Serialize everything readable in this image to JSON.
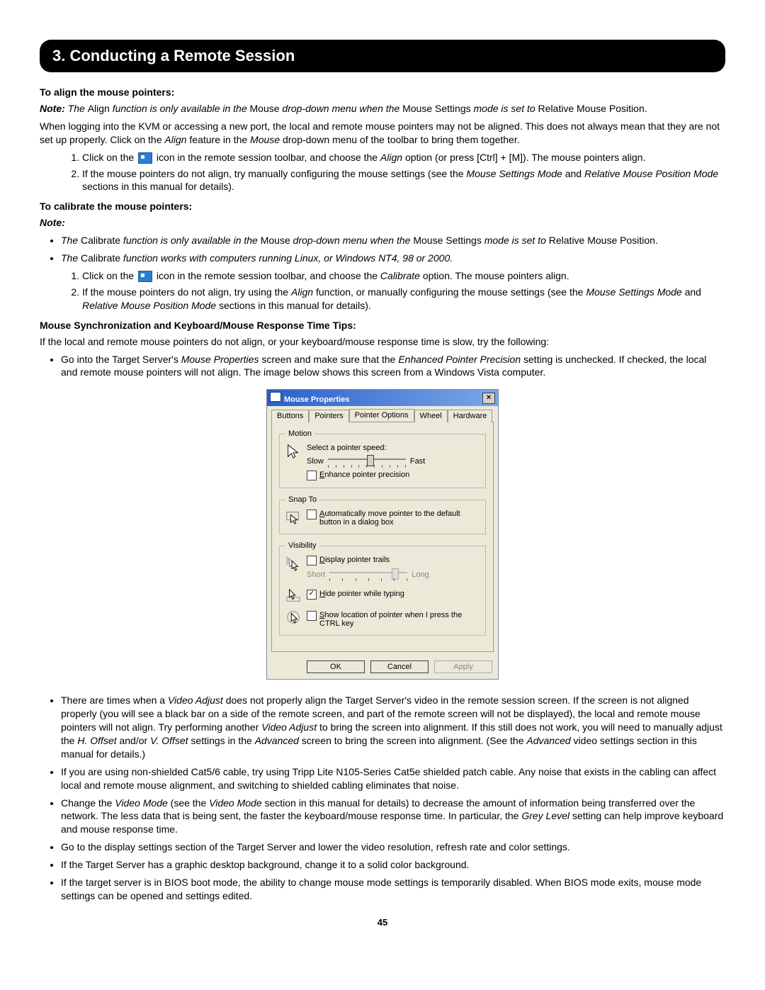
{
  "header": {
    "section_title": "3. Conducting a Remote Session"
  },
  "align": {
    "heading": "To align the mouse pointers:",
    "note_label": "Note:",
    "note_pre": " The ",
    "note_align_word": "Align",
    "note_mid1": " function is only available in the ",
    "note_mouse_word": "Mouse",
    "note_mid2": " drop-down menu when the ",
    "note_settings_word": "Mouse Settings",
    "note_mid3": " mode is set to ",
    "note_relative_word": "Relative Mouse Position.",
    "para1": "When logging into the KVM or accessing a new port, the local and remote mouse pointers may not be aligned. This does not always mean that they are not set up properly. Click on the ",
    "para1_em1": "Align",
    "para1_mid": " feature in the ",
    "para1_em2": "Mouse",
    "para1_end": " drop-down menu of the toolbar to bring them together.",
    "step1_a": "Click on the ",
    "step1_b": " icon in the remote session toolbar, and choose the ",
    "step1_em": "Align",
    "step1_c": " option (or press [Ctrl] + [M]). The mouse pointers align.",
    "step2_a": "If the mouse pointers do not align, try manually configuring the mouse settings (see the ",
    "step2_em1": "Mouse Settings Mode",
    "step2_mid": " and ",
    "step2_em2": "Relative Mouse Position Mode",
    "step2_end": " sections in this manual for details)."
  },
  "calibrate": {
    "heading": "To calibrate the mouse pointers:",
    "note_label": "Note:",
    "b1_a": "The ",
    "b1_cal": "Calibrate",
    "b1_b": " function is only available in the ",
    "b1_mouse": "Mouse",
    "b1_c": " drop-down menu when the ",
    "b1_settings": "Mouse Settings",
    "b1_d": " mode is set to ",
    "b1_relative": "Relative Mouse Position.",
    "b2_a": "The ",
    "b2_cal": "Calibrate",
    "b2_b": " function works with computers running Linux, or Windows NT4, 98 or 2000.",
    "step1_a": "Click on the ",
    "step1_b": " icon in the remote session toolbar, and choose the ",
    "step1_em": "Calibrate",
    "step1_c": " option. The mouse pointers align.",
    "step2_a": "If the mouse pointers do not align, try using the ",
    "step2_em1": "Align",
    "step2_b": " function, or manually configuring the mouse settings (see the ",
    "step2_em2": "Mouse Settings Mode",
    "step2_mid": " and ",
    "step2_em3": "Relative Mouse Position Mode",
    "step2_end": " sections in this manual for details)."
  },
  "sync": {
    "heading": "Mouse Synchronization and Keyboard/Mouse Response Time Tips:",
    "intro": "If the local and remote mouse pointers do not align, or your keyboard/mouse response time is slow, try the following:",
    "b1_a": "Go into the Target Server's ",
    "b1_em1": "Mouse Properties",
    "b1_b": " screen and make sure that the ",
    "b1_em2": "Enhanced Pointer Precision",
    "b1_c": " setting is unchecked. If checked, the local and remote mouse pointers will not align. The image below shows this screen from a Windows Vista computer.",
    "b2_a": "There are times when a ",
    "b2_em1": "Video Adjust",
    "b2_b": " does not properly align the Target Server's video in the remote session screen. If the screen is not aligned properly (you will see a black bar on a side of the remote screen, and part of the remote screen will not be displayed), the local and remote mouse pointers will not align. Try performing another ",
    "b2_em2": "Video Adjust",
    "b2_c": " to bring the screen into alignment. If this still does not work, you will need to manually adjust the ",
    "b2_em3": "H. Offset",
    "b2_d": " and/or ",
    "b2_em4": "V. Offset",
    "b2_e": " settings in the ",
    "b2_em5": "Advanced",
    "b2_f": " screen to bring the screen into alignment. (See the ",
    "b2_em6": "Advanced",
    "b2_g": " video settings section in this manual for details.)",
    "b3": "If you are using non-shielded Cat5/6 cable, try using Tripp Lite N105-Series Cat5e shielded patch cable. Any noise that exists in the cabling can affect local and remote mouse alignment, and switching to shielded cabling eliminates that noise.",
    "b4_a": "Change the ",
    "b4_em1": "Video Mode",
    "b4_b": " (see the ",
    "b4_em2": "Video Mode",
    "b4_c": " section in this manual for details) to decrease the amount of information being transferred over the network. The less data that is being sent, the faster the keyboard/mouse response time. In particular, the ",
    "b4_em3": "Grey Level",
    "b4_d": " setting can help improve keyboard and mouse response time.",
    "b5": "Go to the display settings section of the Target Server and lower the video resolution, refresh rate and color settings.",
    "b6": "If the Target Server has a graphic desktop background, change it to a solid color background.",
    "b7": "If the target server is in BIOS boot mode, the ability to change mouse mode settings is temporarily disabled. When BIOS mode exits, mouse mode settings can be opened and settings edited."
  },
  "dialog": {
    "title": "Mouse Properties",
    "tabs": [
      "Buttons",
      "Pointers",
      "Pointer Options",
      "Wheel",
      "Hardware"
    ],
    "active_tab": 2,
    "motion": {
      "legend": "Motion",
      "label": "Select a pointer speed:",
      "slow": "Slow",
      "fast": "Fast",
      "checkbox": "Enhance pointer precision",
      "checked": false
    },
    "snap": {
      "legend": "Snap To",
      "checkbox": "Automatically move pointer to the default button in a dialog box",
      "checked": false
    },
    "visibility": {
      "legend": "Visibility",
      "trails_checkbox": "Display pointer trails",
      "trails_checked": false,
      "short": "Short",
      "long": "Long",
      "hide_checkbox": "Hide pointer while typing",
      "hide_checked": true,
      "ctrl_checkbox": "Show location of pointer when I press the CTRL key",
      "ctrl_checked": false
    },
    "buttons": {
      "ok": "OK",
      "cancel": "Cancel",
      "apply": "Apply"
    }
  },
  "page_number": "45"
}
